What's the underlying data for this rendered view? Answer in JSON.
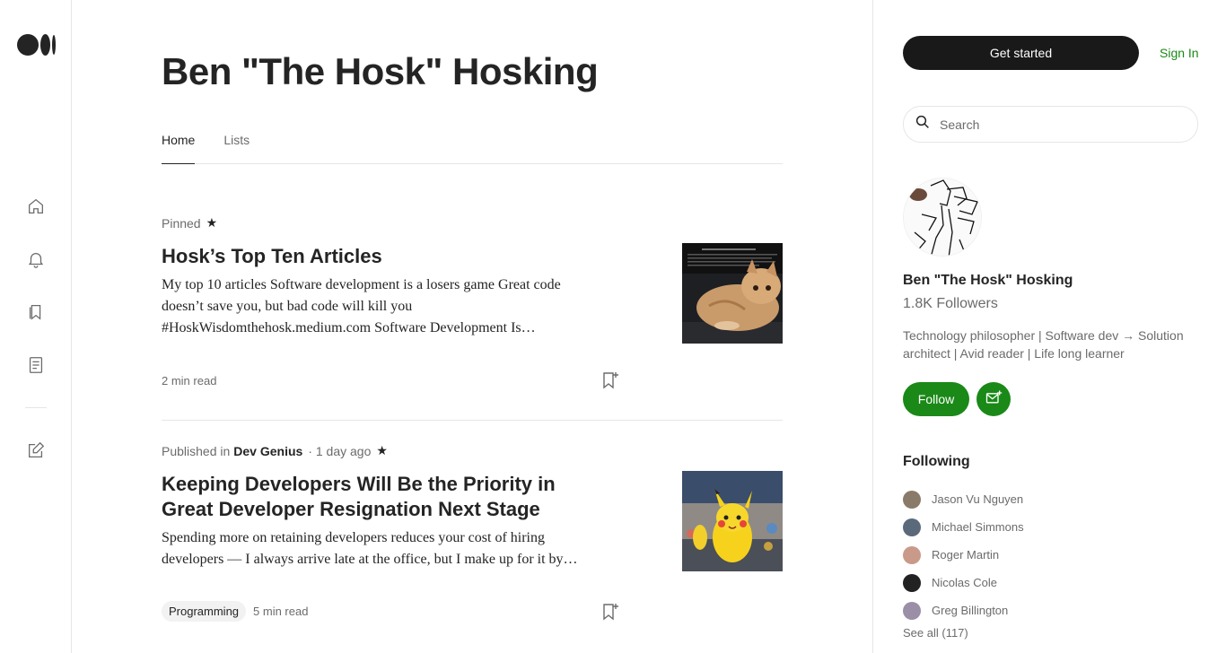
{
  "profile": {
    "name": "Ben \"The Hosk\" Hosking",
    "followers": "1.8K Followers",
    "bio": "Technology philosopher | Software dev → Solution architect | Avid reader | Life long learner"
  },
  "nav": {
    "icons": [
      "home-icon",
      "notifications-icon",
      "library-icon",
      "stories-icon",
      "write-icon"
    ]
  },
  "tabs": [
    {
      "label": "Home",
      "active": true
    },
    {
      "label": "Lists",
      "active": false
    }
  ],
  "header": {
    "get_started": "Get started",
    "sign_in": "Sign In"
  },
  "search": {
    "placeholder": "Search"
  },
  "actions": {
    "follow": "Follow"
  },
  "articles": [
    {
      "meta_prefix": "Pinned",
      "star": "★",
      "title": "Hosk’s Top Ten Articles",
      "snippet": "My top 10 articles Software development is a losers game Great code doesn’t save you, but bad code will kill you #HoskWisdomthehosk.medium.com Software Development Is…",
      "read_time": "2 min read",
      "thumbnail": "cat-on-laptop"
    },
    {
      "meta_prefix": "Published in",
      "publication": "Dev Genius",
      "date": "· 1 day ago",
      "star": "★",
      "title": "Keeping Developers Will Be the Priority in Great Developer Resignation Next Stage",
      "snippet": "Spending more on retaining developers reduces your cost of hiring developers — I always arrive late at the office, but I make up for it by…",
      "tag": "Programming",
      "read_time": "5 min read",
      "thumbnail": "pikachu-parade"
    }
  ],
  "following": {
    "heading": "Following",
    "items": [
      {
        "name": "Jason Vu Nguyen",
        "color": "#8a7a6a"
      },
      {
        "name": "Michael Simmons",
        "color": "#5a6a7a"
      },
      {
        "name": "Roger Martin",
        "color": "#c99a8a"
      },
      {
        "name": "Nicolas Cole",
        "color": "#222222"
      },
      {
        "name": "Greg Billington",
        "color": "#9a8fa6"
      }
    ],
    "see_all": "See all (117)"
  },
  "colors": {
    "accent_green": "#1a8917",
    "dark_button": "#191919",
    "text_primary": "#242424",
    "text_secondary": "#6b6b6b"
  }
}
